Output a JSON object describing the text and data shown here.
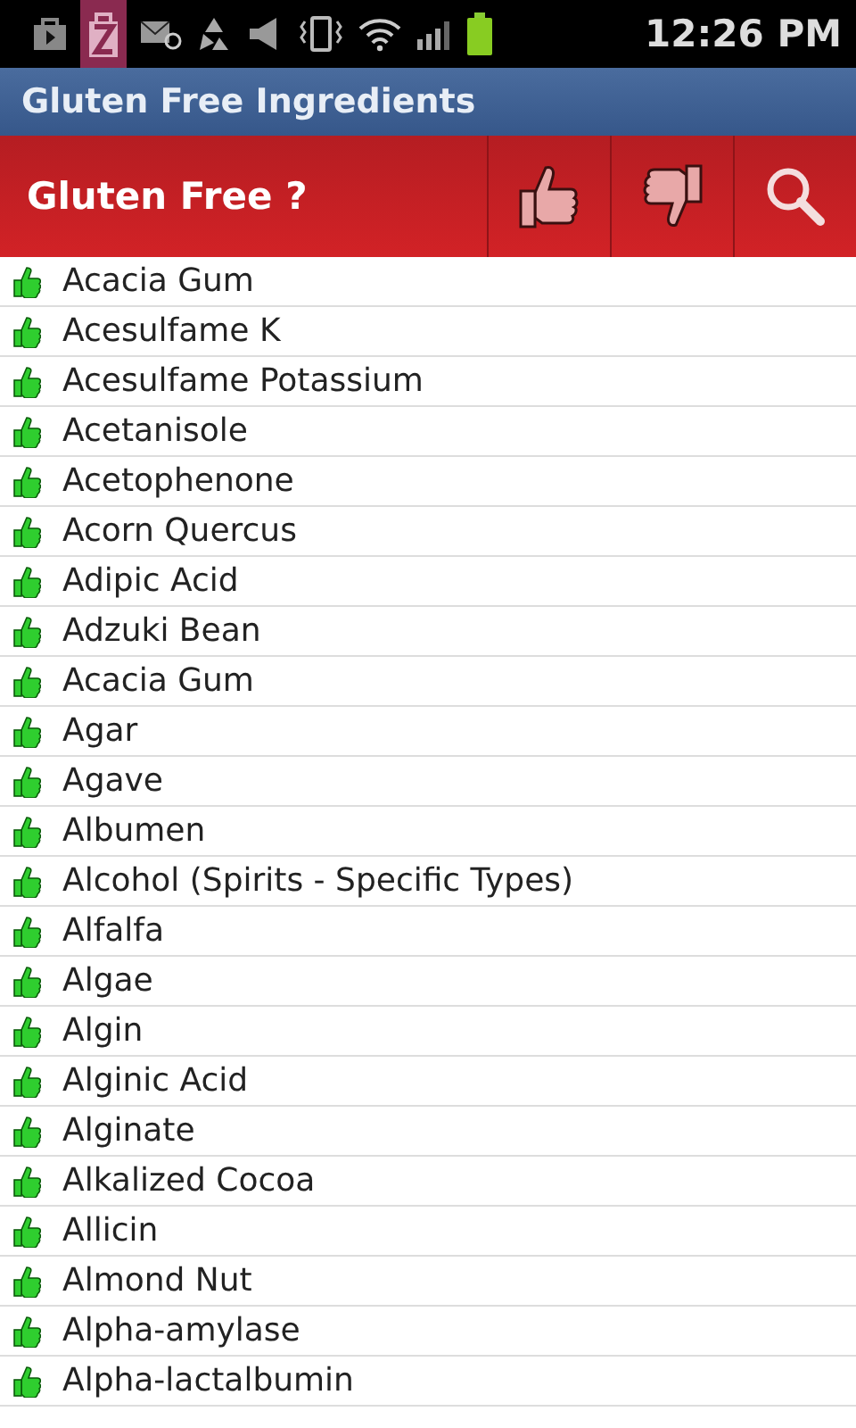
{
  "status_bar": {
    "time": "12:26 PM"
  },
  "window": {
    "title": "Gluten Free Ingredients"
  },
  "action_bar": {
    "title": "Gluten Free ?"
  },
  "ingredients": [
    "Acacia Gum",
    "Acesulfame K",
    "Acesulfame Potassium",
    "Acetanisole",
    "Acetophenone",
    "Acorn Quercus",
    "Adipic Acid",
    "Adzuki Bean",
    "Acacia Gum",
    "Agar",
    "Agave",
    "Albumen",
    "Alcohol (Spirits - Specific Types)",
    "Alfalfa",
    "Algae",
    "Algin",
    "Alginic Acid",
    "Alginate",
    "Alkalized Cocoa",
    "Allicin",
    "Almond Nut",
    "Alpha-amylase",
    "Alpha-lactalbumin"
  ]
}
